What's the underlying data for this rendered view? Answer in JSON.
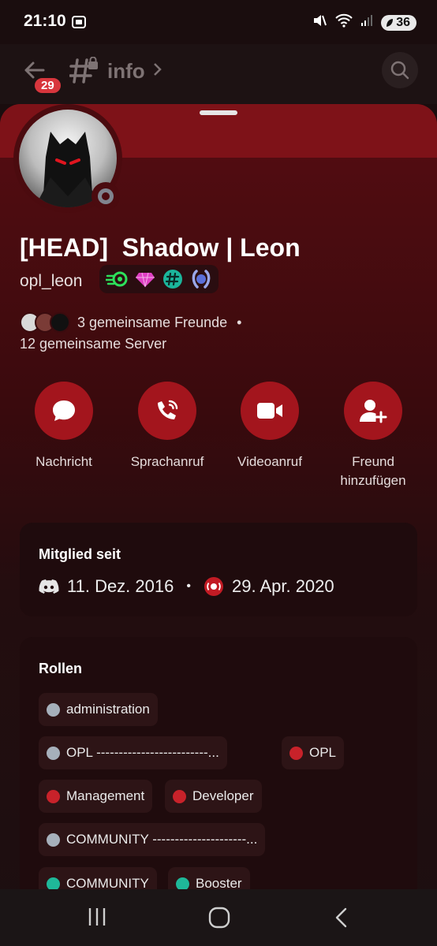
{
  "status_bar": {
    "time": "21:10",
    "battery": "36"
  },
  "header": {
    "back_badge": "29",
    "channel": "info"
  },
  "profile": {
    "display_name": "[HEAD]  Shadow | Leon",
    "username": "opl_leon",
    "badge_icons": [
      "nitro-badge-icon",
      "diamond-badge-icon",
      "hashtag-badge-icon",
      "laurel-badge-icon"
    ],
    "mutual_friends": "3 gemeinsame Freunde",
    "mutual_servers": "12 gemeinsame Server"
  },
  "actions": [
    {
      "label": "Nachricht",
      "icon": "chat-bubble-icon"
    },
    {
      "label": "Sprachanruf",
      "icon": "phone-icon"
    },
    {
      "label": "Videoanruf",
      "icon": "video-camera-icon"
    },
    {
      "label": "Freund\nhinzufügen",
      "icon": "add-friend-icon"
    }
  ],
  "member_since": {
    "title": "Mitglied seit",
    "discord_date": "11. Dez. 2016",
    "server_date": "29. Apr. 2020"
  },
  "roles": {
    "title": "Rollen",
    "items": [
      {
        "name": "administration",
        "color": "#a6b0bb"
      },
      {
        "name": "OPL -------------------------...",
        "color": "#a6b0bb"
      },
      {
        "name": "OPL",
        "color": "#c8222a"
      },
      {
        "name": "Management",
        "color": "#c8222a"
      },
      {
        "name": "Developer",
        "color": "#c8222a"
      },
      {
        "name": "COMMUNITY ---------------------...",
        "color": "#a6b0bb"
      },
      {
        "name": "COMMUNITY",
        "color": "#1fb899"
      },
      {
        "name": "Booster",
        "color": "#1fb899"
      }
    ]
  },
  "colors": {
    "accent": "#a3151d",
    "banner": "#7e1218"
  }
}
